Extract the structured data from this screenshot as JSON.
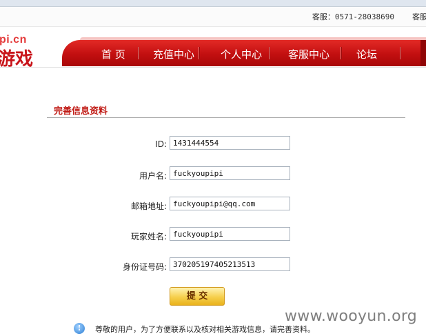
{
  "service": {
    "label": "客服：",
    "phone": "0571-28038690",
    "label_cut": "客服"
  },
  "logo": {
    "domain": "pi.cn",
    "word": "游戏"
  },
  "nav": {
    "items": [
      {
        "label": "首 页"
      },
      {
        "label": "充值中心"
      },
      {
        "label": "个人中心"
      },
      {
        "label": "客服中心"
      },
      {
        "label": "论坛"
      }
    ]
  },
  "form": {
    "title": "完善信息资料",
    "fields": [
      {
        "label": "ID:",
        "value": "1431444554"
      },
      {
        "label": "用户名:",
        "value": "fuckyoupipi"
      },
      {
        "label": "邮箱地址:",
        "value": "fuckyoupipi@qq.com"
      },
      {
        "label": "玩家姓名:",
        "value": "fuckyoupipi"
      },
      {
        "label": "身份证号码:",
        "value": "370205197405213513"
      }
    ],
    "submit_label": "提 交",
    "notice": "尊敬的用户，为了方便联系以及核对相关游戏信息，请完善资料。"
  },
  "watermark": "www.wooyun.org",
  "colors": {
    "nav_red": "#c20f10",
    "title_red": "#c01a14",
    "button_gold": "#f6cf4c"
  },
  "icons": {
    "notice": "info-icon"
  }
}
